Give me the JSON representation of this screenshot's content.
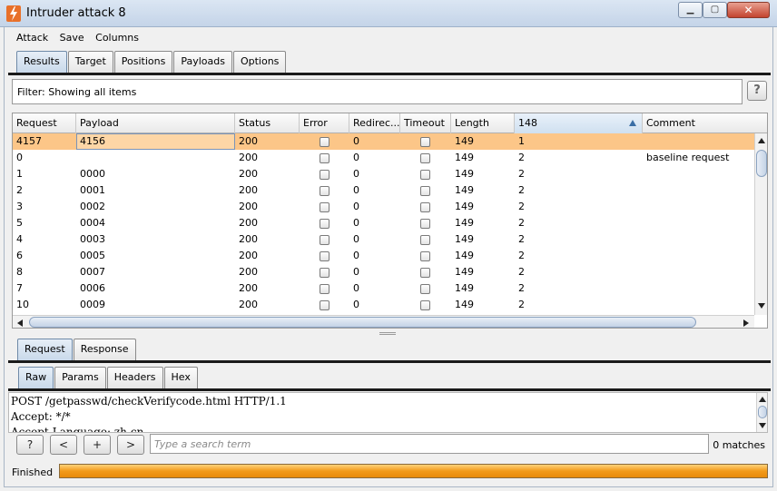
{
  "window": {
    "title": "Intruder attack 8"
  },
  "menu": [
    "Attack",
    "Save",
    "Columns"
  ],
  "main_tabs": [
    {
      "label": "Results",
      "active": true
    },
    {
      "label": "Target",
      "active": false
    },
    {
      "label": "Positions",
      "active": false
    },
    {
      "label": "Payloads",
      "active": false
    },
    {
      "label": "Options",
      "active": false
    }
  ],
  "filter": {
    "text": "Filter:  Showing all items",
    "help_label": "?"
  },
  "table": {
    "columns": [
      "Request",
      "Payload",
      "Status",
      "Error",
      "Redirec...",
      "Timeout",
      "Length",
      "148",
      "Comment"
    ],
    "sorted_column": "148",
    "rows": [
      {
        "request": "4157",
        "payload": "4156",
        "status": "200",
        "error": false,
        "redirects": "0",
        "timeout": false,
        "length": "149",
        "c148": "1",
        "comment": "",
        "selected": true
      },
      {
        "request": "0",
        "payload": "",
        "status": "200",
        "error": false,
        "redirects": "0",
        "timeout": false,
        "length": "149",
        "c148": "2",
        "comment": "baseline request"
      },
      {
        "request": "1",
        "payload": "0000",
        "status": "200",
        "error": false,
        "redirects": "0",
        "timeout": false,
        "length": "149",
        "c148": "2",
        "comment": ""
      },
      {
        "request": "2",
        "payload": "0001",
        "status": "200",
        "error": false,
        "redirects": "0",
        "timeout": false,
        "length": "149",
        "c148": "2",
        "comment": ""
      },
      {
        "request": "3",
        "payload": "0002",
        "status": "200",
        "error": false,
        "redirects": "0",
        "timeout": false,
        "length": "149",
        "c148": "2",
        "comment": ""
      },
      {
        "request": "5",
        "payload": "0004",
        "status": "200",
        "error": false,
        "redirects": "0",
        "timeout": false,
        "length": "149",
        "c148": "2",
        "comment": ""
      },
      {
        "request": "4",
        "payload": "0003",
        "status": "200",
        "error": false,
        "redirects": "0",
        "timeout": false,
        "length": "149",
        "c148": "2",
        "comment": ""
      },
      {
        "request": "6",
        "payload": "0005",
        "status": "200",
        "error": false,
        "redirects": "0",
        "timeout": false,
        "length": "149",
        "c148": "2",
        "comment": ""
      },
      {
        "request": "8",
        "payload": "0007",
        "status": "200",
        "error": false,
        "redirects": "0",
        "timeout": false,
        "length": "149",
        "c148": "2",
        "comment": ""
      },
      {
        "request": "7",
        "payload": "0006",
        "status": "200",
        "error": false,
        "redirects": "0",
        "timeout": false,
        "length": "149",
        "c148": "2",
        "comment": ""
      },
      {
        "request": "10",
        "payload": "0009",
        "status": "200",
        "error": false,
        "redirects": "0",
        "timeout": false,
        "length": "149",
        "c148": "2",
        "comment": ""
      }
    ]
  },
  "detail_tabs": [
    {
      "label": "Request",
      "active": true
    },
    {
      "label": "Response",
      "active": false
    }
  ],
  "view_tabs": [
    {
      "label": "Raw",
      "active": true
    },
    {
      "label": "Params",
      "active": false
    },
    {
      "label": "Headers",
      "active": false
    },
    {
      "label": "Hex",
      "active": false
    }
  ],
  "editor": {
    "lines": [
      "POST /getpasswd/checkVerifycode.html HTTP/1.1",
      "Accept: */*",
      "Accept-Language: zh-cn"
    ]
  },
  "search": {
    "help_label": "?",
    "prev_label": "<",
    "add_label": "+",
    "next_label": ">",
    "placeholder": "Type a search term",
    "matches": "0 matches"
  },
  "status": {
    "text": "Finished",
    "progress": 1.0
  },
  "colors": {
    "selected_row": "#fcc688",
    "progress": "#f29a1a",
    "titlebar": "#c4d4e8"
  }
}
